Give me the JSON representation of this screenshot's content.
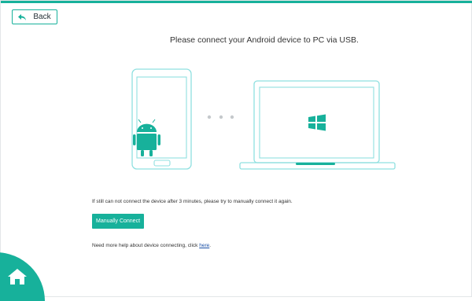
{
  "header": {
    "back_label": "Back"
  },
  "main": {
    "headline": "Please connect your Android device to PC via USB.",
    "note": "If still can not connect the device after 3 minutes, please try to manually connect it again.",
    "manual_button": "Manually Connect",
    "help_prefix": "Need more help about device connecting, click ",
    "help_link": "here",
    "help_suffix": "."
  },
  "icons": {
    "back": "back-arrow-icon",
    "phone": "android-phone-icon",
    "laptop": "windows-laptop-icon",
    "home": "home-icon"
  },
  "colors": {
    "accent": "#17b19b",
    "outline": "#8fe0e0",
    "link": "#1a4fa6"
  }
}
